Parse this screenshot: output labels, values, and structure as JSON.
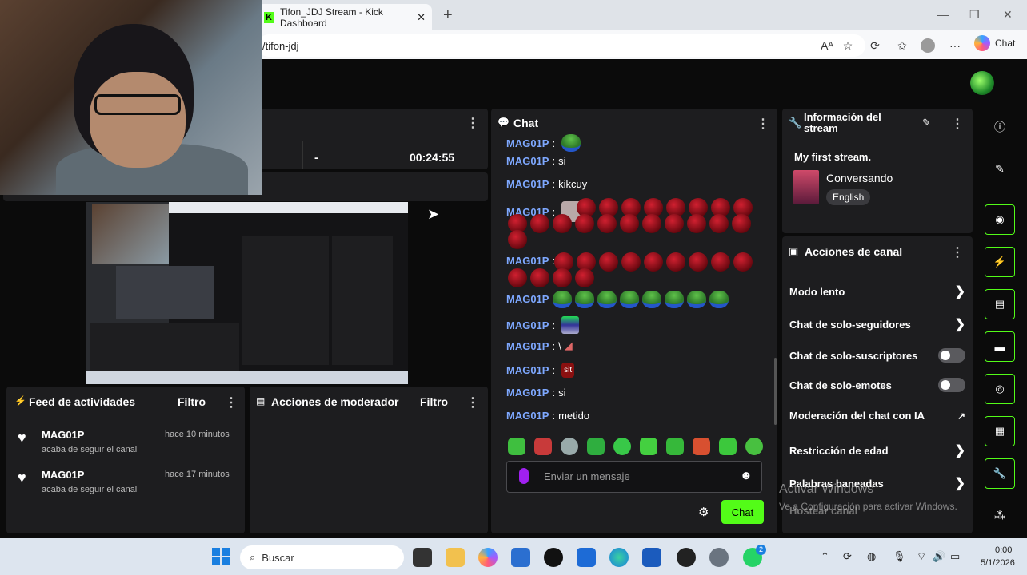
{
  "browser": {
    "tab_title": "Tifon_JDJ Stream - Kick Dashboard",
    "url": "/tifon-jdj",
    "copilot_label": "Chat",
    "window_controls": [
      "—",
      "❐",
      "✕"
    ]
  },
  "stream_stats": {
    "dash": "-",
    "uptime": "00:24:55"
  },
  "activity_feed": {
    "title": "Feed de actividades",
    "filter_label": "Filtro",
    "items": [
      {
        "user": "MAG01P",
        "action": "acaba de seguir el canal",
        "time": "hace 10 minutos"
      },
      {
        "user": "MAG01P",
        "action": "acaba de seguir el canal",
        "time": "hace 17 minutos"
      }
    ]
  },
  "mod_actions": {
    "title": "Acciones de moderador",
    "filter_label": "Filtro"
  },
  "chat": {
    "title": "Chat",
    "messages": [
      {
        "user": "MAG01P",
        "text": ""
      },
      {
        "user": "MAG01P",
        "text": "si"
      },
      {
        "user": "MAG01P",
        "text": "kikcuy"
      },
      {
        "user": "MAG01P",
        "text": ""
      },
      {
        "user": "MAG01P",
        "text": ""
      },
      {
        "user": "MAG01P",
        "text": ""
      },
      {
        "user": "MAG01P",
        "text": ""
      },
      {
        "user": "MAG01P",
        "text": "\\"
      },
      {
        "user": "MAG01P",
        "text": ""
      },
      {
        "user": "MAG01P",
        "text": "si"
      },
      {
        "user": "MAG01P",
        "text": "metido"
      }
    ],
    "emote_sticker_text": "sit",
    "input_placeholder": "Enviar un mensaje",
    "send_label": "Chat"
  },
  "stream_info": {
    "title": "Información del stream",
    "stream_title": "My first stream.",
    "category": "Conversando",
    "language": "English"
  },
  "channel_actions": {
    "title": "Acciones de canal",
    "items": [
      {
        "label": "Modo lento",
        "control": "chevron"
      },
      {
        "label": "Chat de solo-seguidores",
        "control": "chevron"
      },
      {
        "label": "Chat de solo-suscriptores",
        "control": "toggle",
        "on": false
      },
      {
        "label": "Chat de solo-emotes",
        "control": "toggle",
        "on": false
      },
      {
        "label": "Moderación del chat con IA",
        "control": "external"
      },
      {
        "label": "Restricción de edad",
        "control": "chevron"
      },
      {
        "label": "Palabras baneadas",
        "control": "chevron"
      },
      {
        "label": "Hostear canal",
        "control": "none"
      }
    ]
  },
  "watermark": {
    "line1": "Activar Windows",
    "line2": "Ve a Configuración para activar Windows."
  },
  "taskbar": {
    "search_placeholder": "Buscar",
    "time": "0:00",
    "date": "5/1/2026",
    "notification_count": "2"
  },
  "colors": {
    "kick_green": "#53fc18",
    "panel": "#1d1d1f",
    "background": "#0b0b0b",
    "username_blue": "#7ea8ff"
  }
}
